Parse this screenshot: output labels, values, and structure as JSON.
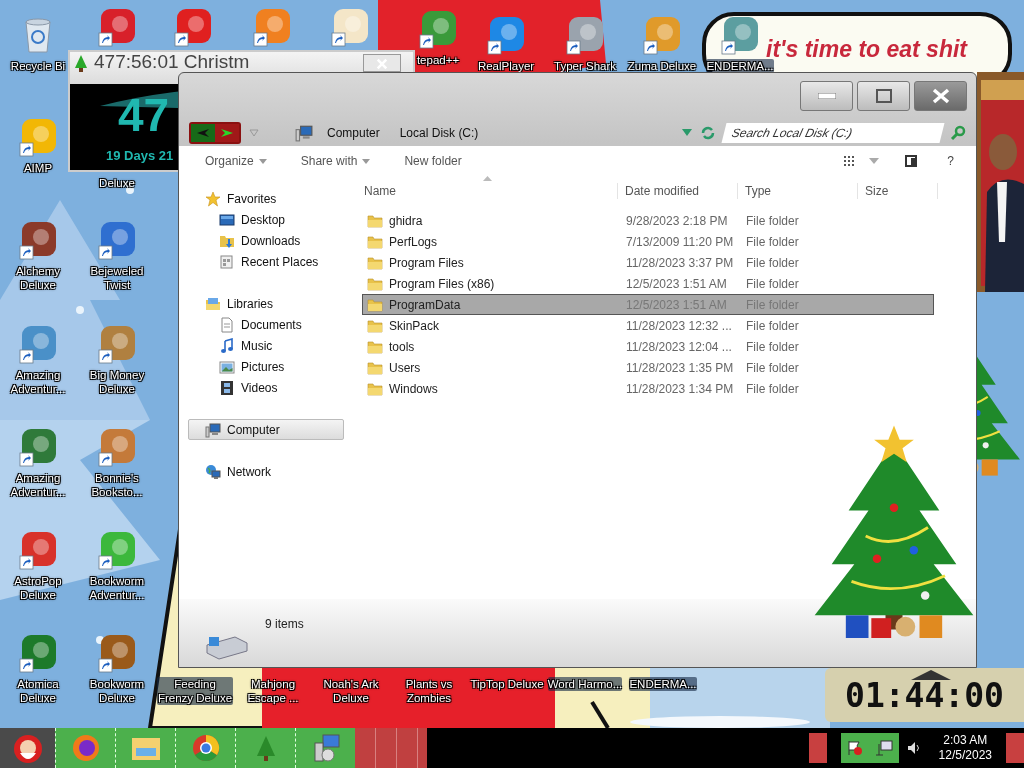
{
  "desktop_icons": [
    {
      "label": "Recycle Bi"
    },
    {
      "label": "tepad++"
    },
    {
      "label": "RealPlayer"
    },
    {
      "label": "Typer Shark"
    },
    {
      "label": "Zuma Deluxe"
    },
    {
      "label": "ENDERMA..."
    },
    {
      "label": "AIMP"
    },
    {
      "label": "Alchemy Deluxe"
    },
    {
      "label": "Amazing Adventur..."
    },
    {
      "label": "Amazing Adventur..."
    },
    {
      "label": "AstroPop Deluxe"
    },
    {
      "label": "Atomica Deluxe"
    },
    {
      "label": "Deluxe"
    },
    {
      "label": "Bejeweled Twist"
    },
    {
      "label": "Big Money Deluxe"
    },
    {
      "label": "Bonnie's Booksto..."
    },
    {
      "label": "Bookworm Adventur..."
    },
    {
      "label": "Bookworm Deluxe"
    },
    {
      "label": "Feeding Frenzy Deluxe"
    },
    {
      "label": "Mahjong Escape ..."
    },
    {
      "label": "Noah's Ark Deluxe"
    },
    {
      "label": "Plants vs Zombies"
    },
    {
      "label": "TipTop Deluxe"
    },
    {
      "label": "Word Harmo..."
    },
    {
      "label": "ENDERMA..."
    }
  ],
  "banner_text": "it's time to eat shit",
  "countdown_gadget": {
    "title": "477:56:01 Christm",
    "big": "47",
    "sub": "19 Days 21"
  },
  "explorer": {
    "address": [
      "Computer",
      "Local Disk (C:)"
    ],
    "search": {
      "placeholder": "Search Local Disk (C:)"
    },
    "toolbar": [
      {
        "label": "Organize",
        "menu": true
      },
      {
        "label": "Share with",
        "menu": true
      },
      {
        "label": "New folder",
        "menu": false
      }
    ],
    "help": "?",
    "nav": [
      {
        "label": "Favorites",
        "selected": false,
        "children": [
          {
            "label": "Desktop",
            "selected": false
          },
          {
            "label": "Downloads",
            "selected": false
          },
          {
            "label": "Recent Places",
            "selected": false
          }
        ]
      },
      {
        "label": "Libraries",
        "selected": false,
        "children": [
          {
            "label": "Documents",
            "selected": false
          },
          {
            "label": "Music",
            "selected": false
          },
          {
            "label": "Pictures",
            "selected": false
          },
          {
            "label": "Videos",
            "selected": false
          }
        ]
      },
      {
        "label": "Computer",
        "selected": true
      },
      {
        "label": "Network",
        "selected": false
      }
    ],
    "columns": [
      "Name",
      "Date modified",
      "Type",
      "Size"
    ],
    "files": [
      {
        "name": "ghidra",
        "date": "9/28/2023 2:18 PM",
        "type": "File folder",
        "selected": false
      },
      {
        "name": "PerfLogs",
        "date": "7/13/2009 11:20 PM",
        "type": "File folder",
        "selected": false
      },
      {
        "name": "Program Files",
        "date": "11/28/2023 3:37 PM",
        "type": "File folder",
        "selected": false
      },
      {
        "name": "Program Files (x86)",
        "date": "12/5/2023 1:51 AM",
        "type": "File folder",
        "selected": false
      },
      {
        "name": "ProgramData",
        "date": "12/5/2023 1:51 AM",
        "type": "File folder",
        "selected": true
      },
      {
        "name": "SkinPack",
        "date": "11/28/2023 12:32 ...",
        "type": "File folder",
        "selected": false
      },
      {
        "name": "tools",
        "date": "11/28/2023 12:04 ...",
        "type": "File folder",
        "selected": false
      },
      {
        "name": "Users",
        "date": "11/28/2023 1:35 PM",
        "type": "File folder",
        "selected": false
      },
      {
        "name": "Windows",
        "date": "11/28/2023 1:34 PM",
        "type": "File folder",
        "selected": false
      }
    ],
    "status": "9 items"
  },
  "clock_gadget": {
    "time": "01:44:00"
  },
  "taskbar": {
    "time": "2:03 AM",
    "date": "12/5/2023"
  }
}
